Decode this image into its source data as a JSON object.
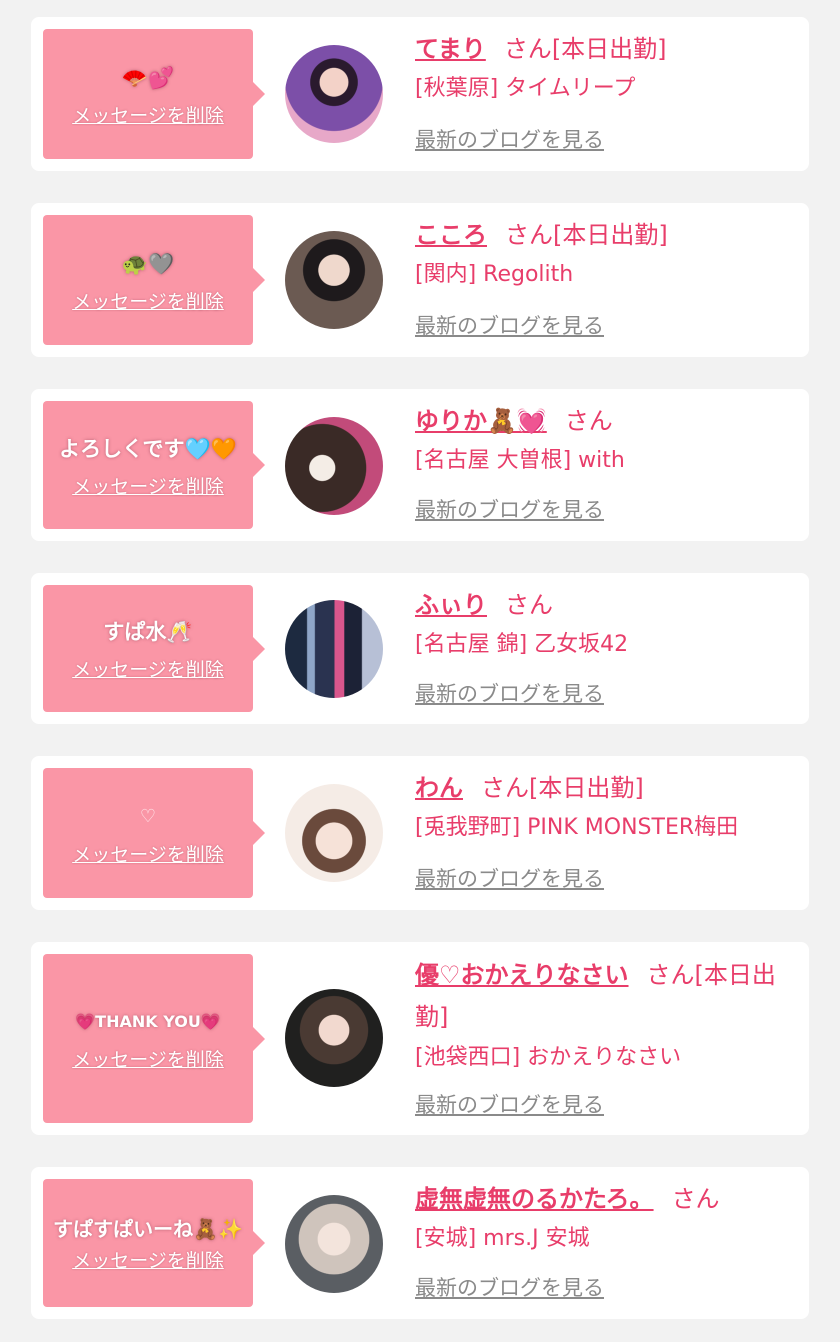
{
  "delete_label": "メッセージを削除",
  "blog_label": "最新のブログを見る",
  "honorific": "さん",
  "cards": [
    {
      "message": "🪭💕",
      "name": "てまり",
      "status": "[本日出勤]",
      "shop": "[秋葉原] タイムリープ"
    },
    {
      "message": "🐢🩶",
      "name": "こころ",
      "status": "[本日出勤]",
      "shop": "[関内] Regolith"
    },
    {
      "message": "よろしくです🩵🧡",
      "name": "ゆりか🧸💓",
      "status": "",
      "shop": "[名古屋 大曽根] with"
    },
    {
      "message": "すぱ水🥂",
      "name": "ふぃり",
      "status": "",
      "shop": "[名古屋 錦] 乙女坂42"
    },
    {
      "message": "♡",
      "name": "わん",
      "status": "[本日出勤]",
      "shop": "[兎我野町] PINK MONSTER梅田"
    },
    {
      "message": "💗THANK YOU💗",
      "name": "優♡おかえりなさい",
      "status": "[本日出勤]",
      "shop": "[池袋西口] おかえりなさい"
    },
    {
      "message": "すぱすぱいーね🧸✨",
      "name": "虚無虚無のるかたろ。",
      "status": "",
      "shop": "[安城] mrs.J 安城"
    }
  ],
  "colors": {
    "accent": "#e83d6a",
    "bubble": "#fa96a6",
    "link_gray": "#8a8a8a",
    "background": "#f2f2f2"
  }
}
